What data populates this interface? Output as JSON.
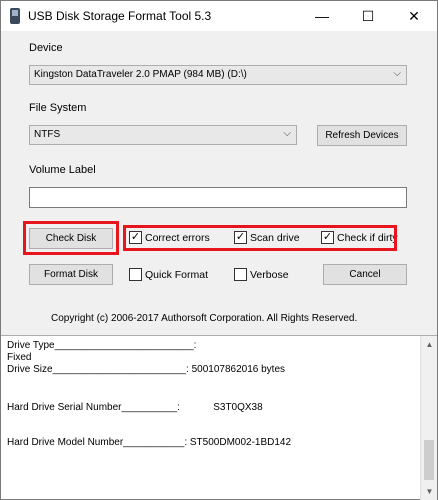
{
  "window": {
    "title": "USB Disk Storage Format Tool 5.3",
    "controls": {
      "minimize": "—",
      "maximize": "☐",
      "close": "✕"
    }
  },
  "device": {
    "label": "Device",
    "selected": "Kingston  DataTraveler 2.0  PMAP (984 MB) (D:\\)"
  },
  "file_system": {
    "label": "File System",
    "selected": "NTFS",
    "refresh_label": "Refresh Devices"
  },
  "volume_label": {
    "label": "Volume Label",
    "value": ""
  },
  "check": {
    "button_label": "Check Disk",
    "correct_errors": {
      "label": "Correct errors",
      "checked": true
    },
    "scan_drive": {
      "label": "Scan drive",
      "checked": true
    },
    "check_if_dirty": {
      "label": "Check if dirty",
      "checked": true
    }
  },
  "format": {
    "button_label": "Format Disk",
    "quick_format": {
      "label": "Quick Format",
      "checked": false
    },
    "verbose": {
      "label": "Verbose",
      "checked": false
    },
    "cancel_label": "Cancel"
  },
  "copyright": "Copyright (c) 2006-2017 Authorsoft Corporation. All Rights Reserved.",
  "output": {
    "lines": [
      "Drive Type_________________________:",
      "Fixed",
      "Drive Size________________________: 500107862016 bytes",
      "",
      "",
      "Hard Drive Serial Number__________:            S3T0QX38",
      "",
      "",
      "Hard Drive Model Number___________: ST500DM002-1BD142"
    ]
  },
  "colors": {
    "highlight": "#e8141e",
    "window_bg": "#f0f0f0"
  }
}
